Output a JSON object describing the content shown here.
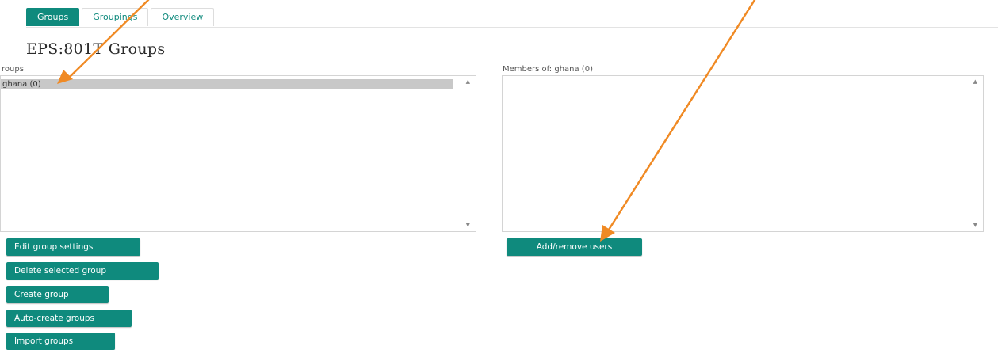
{
  "tabs": [
    {
      "label": "Groups",
      "active": true
    },
    {
      "label": "Groupings",
      "active": false
    },
    {
      "label": "Overview",
      "active": false
    }
  ],
  "page_title": "EPS:801T Groups",
  "groups_panel": {
    "label": "roups",
    "options": [
      {
        "label": "ghana (0)",
        "selected": true
      }
    ]
  },
  "members_panel": {
    "label": "Members of: ghana (0)"
  },
  "buttons": {
    "edit_group_settings": "Edit group settings",
    "delete_selected_group": "Delete selected group",
    "create_group": "Create group",
    "auto_create_groups": "Auto-create groups",
    "import_groups": "Import groups",
    "add_remove_users": "Add/remove users"
  },
  "colors": {
    "accent": "#0f8a7d",
    "annotation_arrow": "#f08a24",
    "selected_option": "#c8c8c8"
  }
}
